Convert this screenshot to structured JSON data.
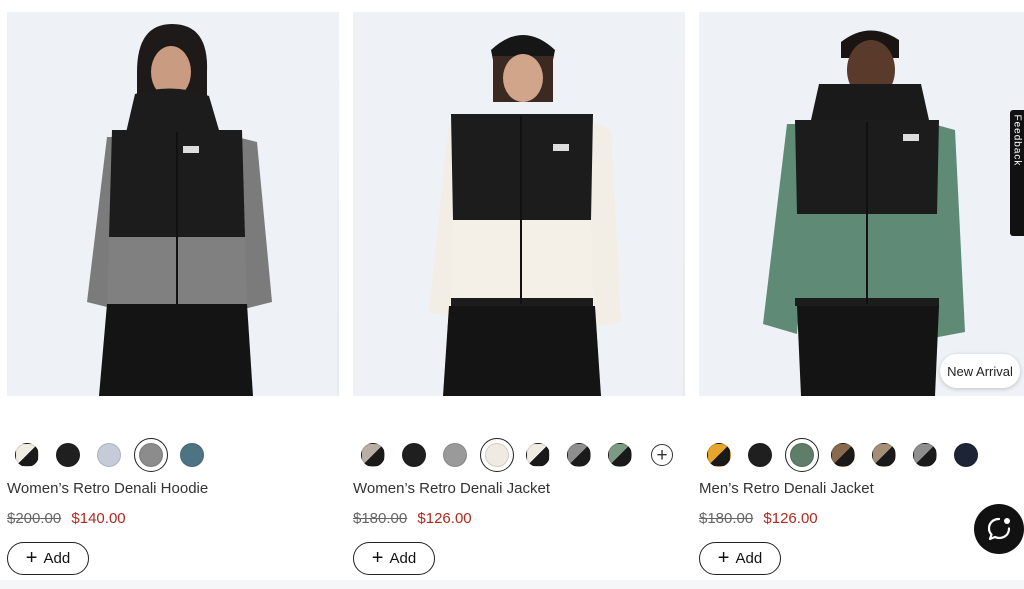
{
  "products": [
    {
      "name": "Women’s Retro Denali Hoodie",
      "original_price": "$200.00",
      "sale_price": "$140.00",
      "add_label": "Add",
      "image_alt": "Women’s Retro Denali Hoodie in grey and black",
      "selected_swatch": 3,
      "swatches": [
        "cream-black",
        "black",
        "light-blue-grey",
        "medium-grey",
        "teal-blue"
      ]
    },
    {
      "name": "Women’s Retro Denali Jacket",
      "original_price": "$180.00",
      "sale_price": "$126.00",
      "add_label": "Add",
      "image_alt": "Women’s Retro Denali Jacket in white and black",
      "selected_swatch": 3,
      "swatches": [
        "taupe-black",
        "black",
        "medium-grey",
        "cream-white",
        "cream-black",
        "grey-black",
        "sage-black"
      ],
      "more_colors": true
    },
    {
      "name": "Men’s Retro Denali Jacket",
      "original_price": "$180.00",
      "sale_price": "$126.00",
      "add_label": "Add",
      "image_alt": "Men’s Retro Denali Jacket in green and black",
      "selected_swatch": 2,
      "swatches": [
        "yellow-black",
        "black",
        "green",
        "brown-black",
        "khaki-black",
        "grey-black",
        "navy"
      ],
      "badge": "New Arrival"
    }
  ],
  "feedback_label": "Feedback",
  "colors": {
    "sale": "#b0291f",
    "text": "#333333",
    "button_border": "#222222"
  },
  "icons": [
    "plus-icon",
    "chat-icon",
    "add-more-colors-icon"
  ]
}
